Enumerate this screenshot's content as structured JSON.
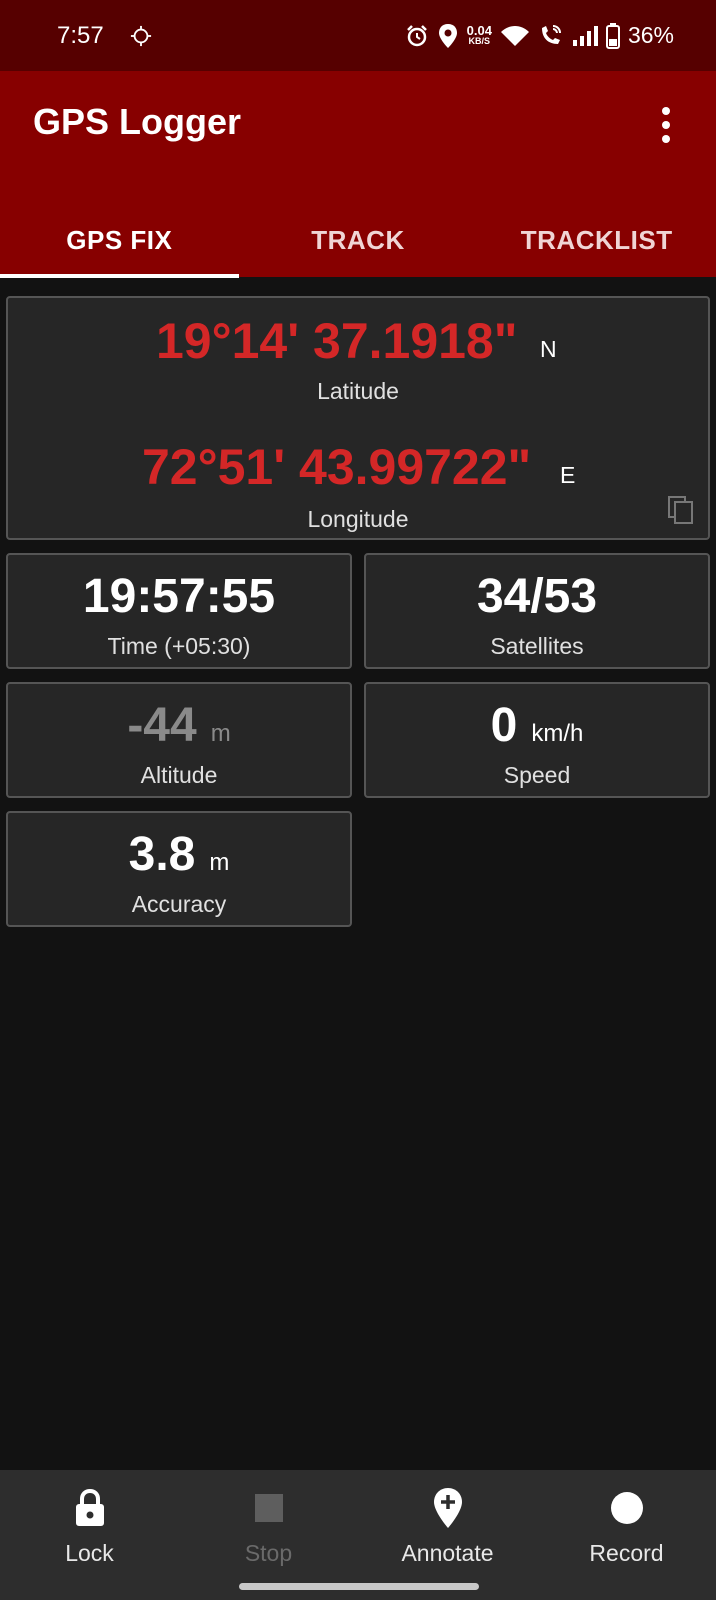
{
  "status_bar": {
    "time": "7:57",
    "net_speed_value": "0.04",
    "net_speed_unit": "KB/S",
    "battery": "36%"
  },
  "app_bar": {
    "title": "GPS Logger",
    "tabs": [
      {
        "label": "GPS FIX",
        "active": true
      },
      {
        "label": "TRACK",
        "active": false
      },
      {
        "label": "TRACKLIST",
        "active": false
      }
    ]
  },
  "fix": {
    "latitude_value": "19°14' 37.1918\"",
    "latitude_dir": "N",
    "latitude_label": "Latitude",
    "longitude_value": "72°51' 43.99722\"",
    "longitude_dir": "E",
    "longitude_label": "Longitude",
    "time_value": "19:57:55",
    "time_label": "Time (+05:30)",
    "satellites_value": "34/53",
    "satellites_label": "Satellites",
    "altitude_value": "-44",
    "altitude_unit": "m",
    "altitude_label": "Altitude",
    "speed_value": "0",
    "speed_unit": "km/h",
    "speed_label": "Speed",
    "accuracy_value": "3.8",
    "accuracy_unit": "m",
    "accuracy_label": "Accuracy"
  },
  "bottom_bar": {
    "lock_label": "Lock",
    "stop_label": "Stop",
    "annotate_label": "Annotate",
    "record_label": "Record"
  },
  "colors": {
    "status_bar": "#560000",
    "app_bar": "#870000",
    "coordinate_text": "#d42727",
    "background": "#121212",
    "card": "#262626"
  },
  "icons": [
    "sync-icon",
    "alarm-icon",
    "location-icon",
    "wifi-icon",
    "wifi-call-icon",
    "signal-icon",
    "battery-icon",
    "overflow-menu-icon",
    "copy-icon",
    "lock-icon",
    "stop-icon",
    "annotate-icon",
    "record-icon"
  ]
}
